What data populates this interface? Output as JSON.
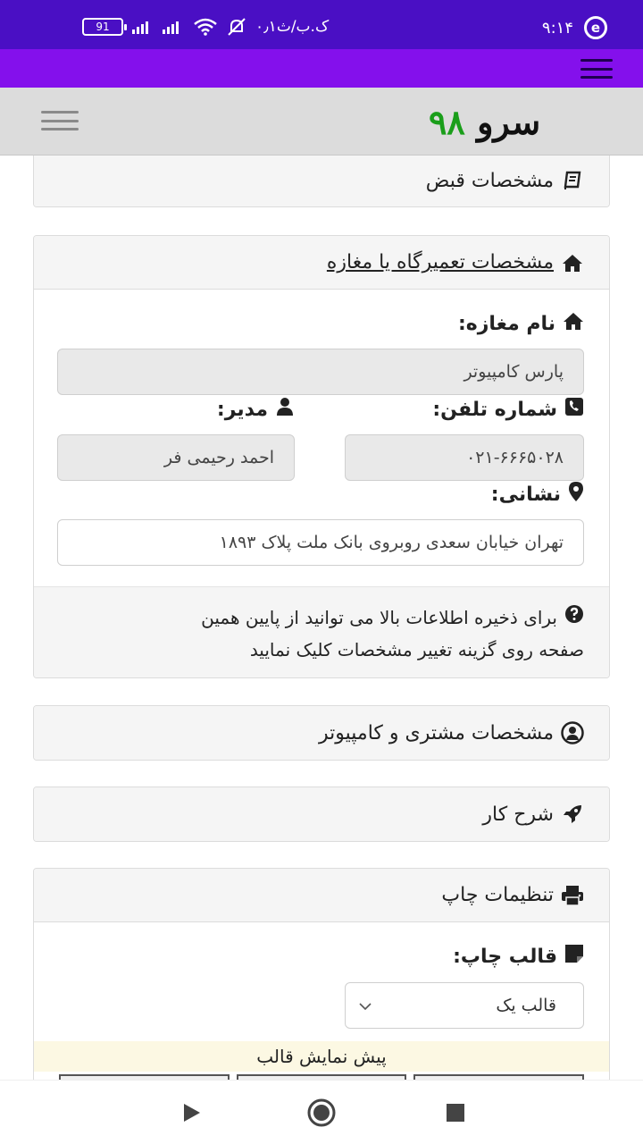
{
  "status_bar": {
    "battery": "91",
    "network_label": "۰٫۱ک.ب/ث",
    "time": "۹:۱۴",
    "icons": [
      "battery-icon",
      "signal-icon",
      "signal-icon",
      "wifi-icon",
      "bell-off-icon",
      "browser-e-icon"
    ]
  },
  "header": {
    "logo_word": "سرو",
    "logo_number": "۹۸",
    "colors": {
      "logo_number": "#1a9e1a",
      "browser_bar": "#8410ec",
      "status_bar": "#4a0fc4"
    }
  },
  "sections": {
    "receipt": {
      "title": "مشخصات قبض",
      "icon": "book-icon"
    },
    "shop": {
      "title": "مشخصات تعمیرگاه یا مغازه",
      "icon": "home-icon",
      "shop_name_label": "نام مغازه:",
      "shop_name_value": "پارس کامپیوتر",
      "phone_label": "شماره تلفن:",
      "phone_value": "۰۲۱-۶۶۶۵۰۲۸",
      "manager_label": "مدیر:",
      "manager_value": "احمد رحیمی فر",
      "address_label": "نشانی:",
      "address_value": "تهران خیابان سعدی روبروی بانک ملت پلاک ۱۸۹۳",
      "help_line1": "برای ذخیره اطلاعات بالا می توانید از پایین همین",
      "help_line2": "صفحه روی گزینه تغییر مشخصات کلیک نمایید"
    },
    "customer": {
      "title": "مشخصات مشتری و کامپیوتر",
      "icon": "user-circle-icon"
    },
    "job": {
      "title": "شرح کار",
      "icon": "rocket-icon"
    },
    "print": {
      "title": "تنظیمات چاپ",
      "icon": "print-icon",
      "template_label": "قالب چاپ:",
      "template_selected": "قالب یک",
      "preview_label": "پیش نمایش قالب"
    }
  }
}
